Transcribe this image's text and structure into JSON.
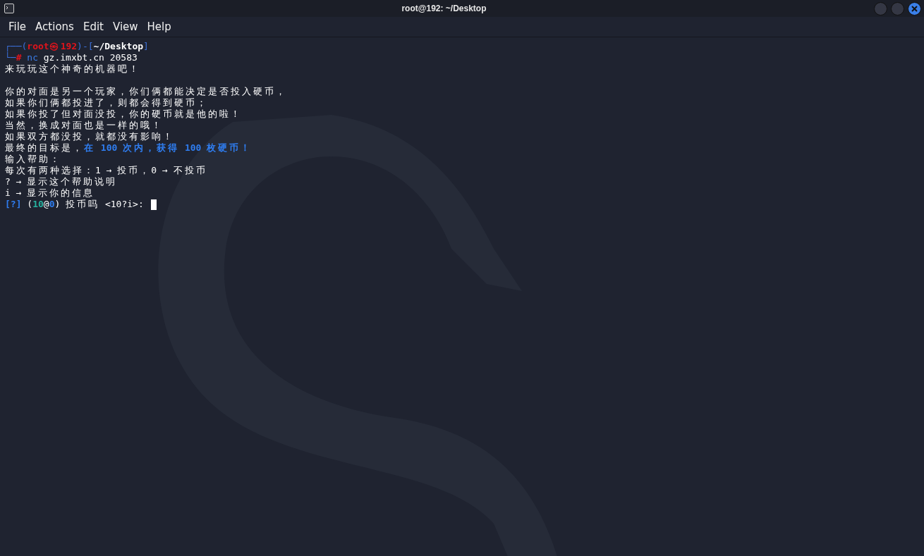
{
  "window": {
    "title": "root@192: ~/Desktop"
  },
  "menu": [
    "File",
    "Actions",
    "Edit",
    "View",
    "Help"
  ],
  "terminal": {
    "lines": [
      {
        "segments": [
          {
            "text": "┌──(",
            "kind": "frame"
          },
          {
            "text": "root㉿192",
            "kind": "user"
          },
          {
            "text": ")-[",
            "kind": "frame"
          },
          {
            "text": "~/Desktop",
            "kind": "path"
          },
          {
            "text": "]",
            "kind": "frame"
          }
        ]
      },
      {
        "segments": [
          {
            "text": "└─",
            "kind": "frame"
          },
          {
            "text": "#",
            "kind": "user"
          },
          {
            "text": " nc",
            "kind": "command"
          },
          {
            "text": " gz.imxbt.cn 20583",
            "kind": "plain"
          }
        ]
      },
      {
        "segments": [
          {
            "text": "来玩玩这个神奇的机器吧！",
            "kind": "plain"
          }
        ]
      },
      {
        "gap_before": true,
        "segments": [
          {
            "text": "你的对面是另一个玩家，你们俩都能决定是否投入硬币，",
            "kind": "plain"
          }
        ]
      },
      {
        "segments": [
          {
            "text": "如果你们俩都投进了，则都会得到硬币；",
            "kind": "plain"
          }
        ]
      },
      {
        "segments": [
          {
            "text": "如果你投了但对面没投，你的硬币就是他的啦！",
            "kind": "plain"
          }
        ]
      },
      {
        "segments": [
          {
            "text": "当然，换成对面也是一样的哦！",
            "kind": "plain"
          }
        ]
      },
      {
        "segments": [
          {
            "text": "如果双方都没投，就都没有影响！",
            "kind": "plain"
          }
        ]
      },
      {
        "segments": [
          {
            "text": "最终的目标是，",
            "kind": "plain"
          },
          {
            "text": "在 100 次内，获得 100 枚硬币！",
            "kind": "highlight"
          }
        ]
      },
      {
        "segments": [
          {
            "text": "输入帮助：",
            "kind": "plain"
          }
        ]
      },
      {
        "segments": [
          {
            "text": "每次有两种选择：1 → 投币，0 → 不投币",
            "kind": "plain"
          }
        ]
      },
      {
        "segments": [
          {
            "text": "? → 显示这个帮助说明",
            "kind": "plain"
          }
        ]
      },
      {
        "segments": [
          {
            "text": "i → 显示你的信息",
            "kind": "plain"
          }
        ]
      },
      {
        "cursor": true,
        "segments": [
          {
            "text": "[?]",
            "kind": "highlight"
          },
          {
            "text": " (",
            "kind": "plain"
          },
          {
            "text": "10",
            "kind": "count"
          },
          {
            "text": "@",
            "kind": "plain"
          },
          {
            "text": "0",
            "kind": "highlight"
          },
          {
            "text": ") 投币吗 <10?i>: ",
            "kind": "plain"
          }
        ]
      }
    ]
  }
}
